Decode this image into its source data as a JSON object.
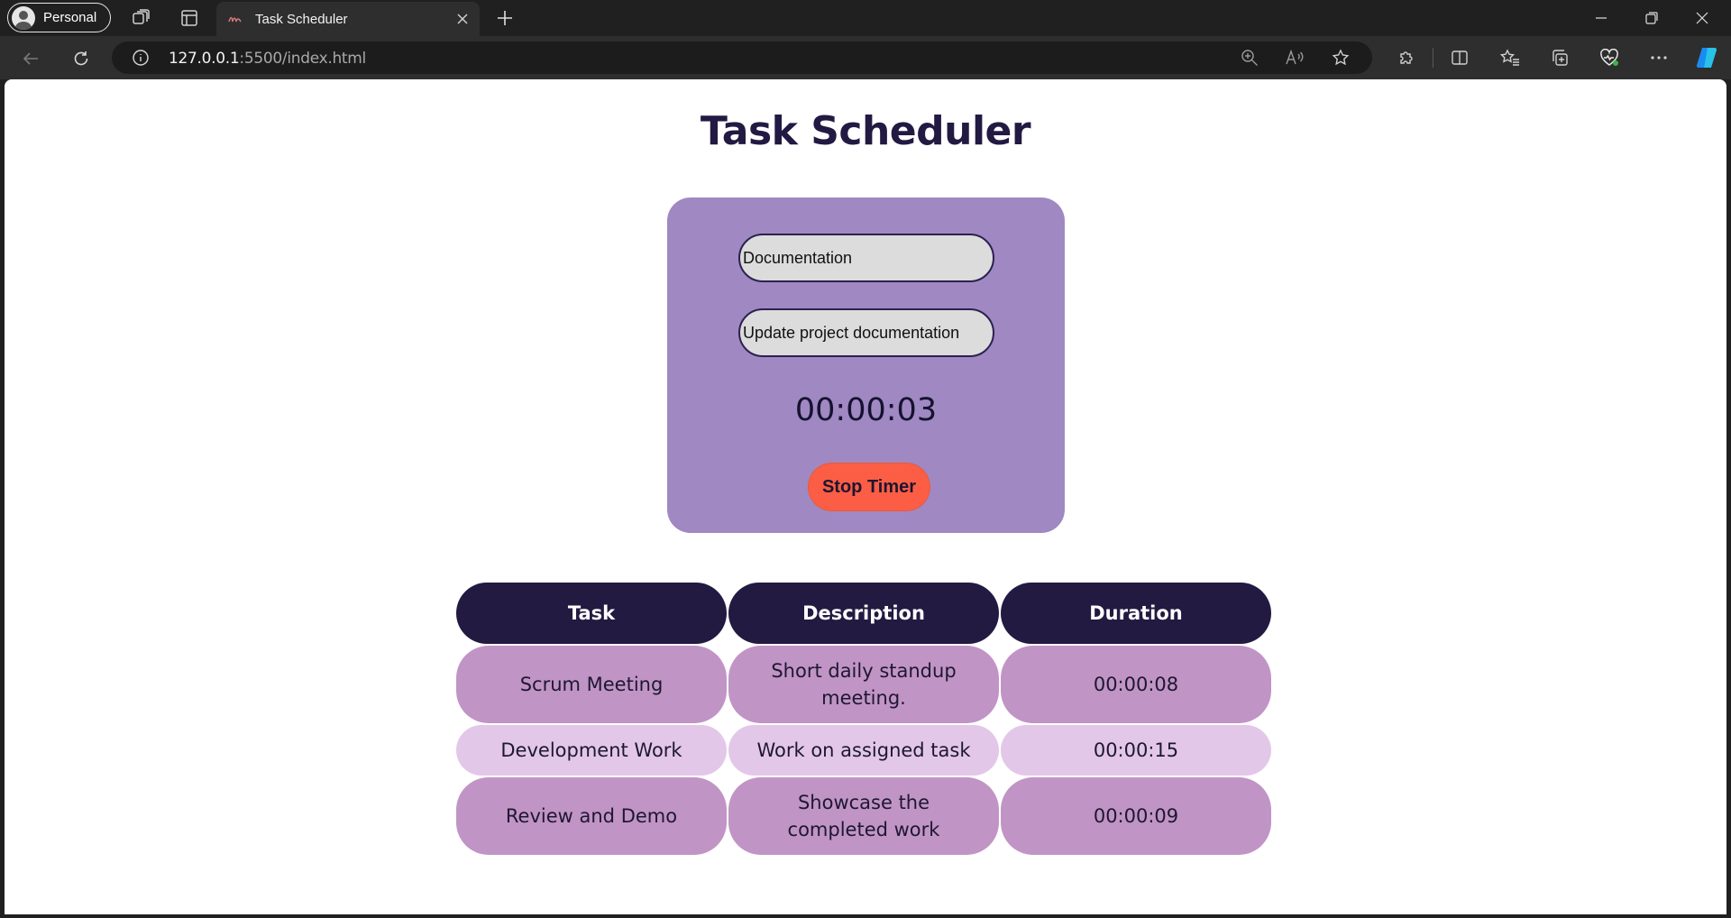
{
  "browser": {
    "profile_label": "Personal",
    "tab_title": "Task Scheduler",
    "url_host": "127.0.0.1",
    "url_rest": ":5500/index.html"
  },
  "page": {
    "title": "Task Scheduler",
    "form": {
      "task_name_value": "Documentation",
      "task_description_value": "Update project documentation",
      "timer_display": "00:00:03",
      "stop_button_label": "Stop Timer"
    },
    "table": {
      "headers": [
        "Task",
        "Description",
        "Duration"
      ],
      "rows": [
        [
          "Scrum Meeting",
          "Short daily standup meeting.",
          "00:00:08"
        ],
        [
          "Development Work",
          "Work on assigned task",
          "00:00:15"
        ],
        [
          "Review and Demo",
          "Showcase the completed work",
          "00:00:09"
        ]
      ]
    }
  },
  "colors": {
    "title": "#221a42",
    "card_bg": "#a088c2",
    "field_bg": "#dcdcdc",
    "stop_button": "#fb5e45",
    "table_header": "#231a42",
    "row_dark": "#c194c6",
    "row_light": "#e3c7e8"
  },
  "icons": [
    "profile-avatar-icon",
    "workspaces-icon",
    "tab-actions-icon",
    "tab-favicon-icon",
    "tab-close-icon",
    "new-tab-icon",
    "minimize-icon",
    "restore-icon",
    "close-window-icon",
    "back-icon",
    "refresh-icon",
    "site-info-icon",
    "zoom-icon",
    "read-aloud-icon",
    "add-favorite-icon",
    "extensions-icon",
    "split-screen-icon",
    "favorites-icon",
    "collections-icon",
    "browser-essentials-icon",
    "more-icon",
    "copilot-icon"
  ]
}
